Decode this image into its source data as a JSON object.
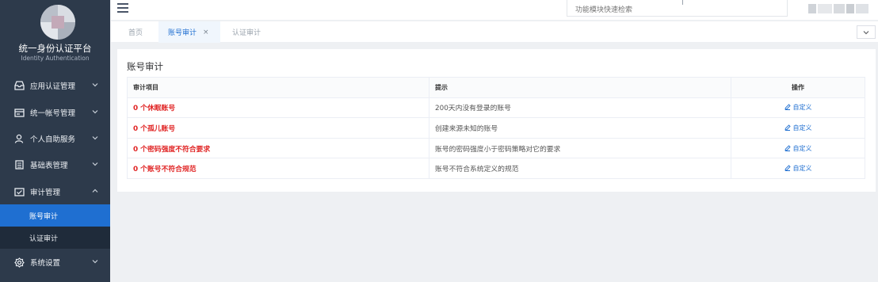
{
  "sidebar": {
    "brand_title": "统一身份认证平台",
    "brand_subtitle": "Identity Authentication",
    "menu": [
      {
        "label": "应用认证管理",
        "icon": "app-icon"
      },
      {
        "label": "统一帐号管理",
        "icon": "account-card-icon"
      },
      {
        "label": "个人自助服务",
        "icon": "user-icon"
      },
      {
        "label": "基础表管理",
        "icon": "table-icon"
      },
      {
        "label": "审计管理",
        "icon": "audit-icon"
      },
      {
        "label": "系统设置",
        "icon": "settings-icon"
      }
    ],
    "submenu": [
      {
        "label": "账号审计",
        "active": true
      },
      {
        "label": "认证审计",
        "active": false
      }
    ]
  },
  "header": {
    "search_placeholder": "功能模块快速检索"
  },
  "tabs": [
    {
      "label": "首页"
    },
    {
      "label": "账号审计",
      "close": "×"
    },
    {
      "label": "认证审计"
    }
  ],
  "content": {
    "title": "账号审计",
    "columns": [
      "审计项目",
      "提示",
      "操作"
    ],
    "rows": [
      {
        "item": "0 个休眠账号",
        "hint": "200天内没有登录的账号",
        "action": "自定义"
      },
      {
        "item": "0 个孤儿账号",
        "hint": "创建来源未知的账号",
        "action": "自定义"
      },
      {
        "item": "0 个密码强度不符合要求",
        "hint": "账号的密码强度小于密码策略对它的要求",
        "action": "自定义"
      },
      {
        "item": "0 个账号不符合规范",
        "hint": "账号不符合系统定义的规范",
        "action": "自定义"
      }
    ]
  },
  "colors": {
    "sidebar_bg": "#2d3a4b",
    "active_blue": "#1f6fd1",
    "alert_red": "#e02424"
  }
}
